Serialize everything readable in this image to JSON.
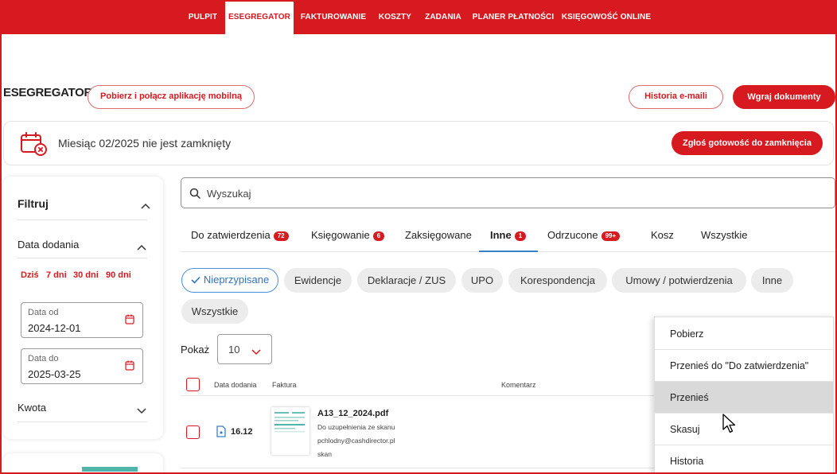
{
  "nav": {
    "items": [
      "PULPIT",
      "ESEGREGATOR",
      "FAKTUROWANIE",
      "KOSZTY",
      "ZADANIA",
      "PLANER PŁATNOŚCI",
      "KSIĘGOWOŚĆ ONLINE"
    ],
    "active": "ESEGREGATOR"
  },
  "header": {
    "title": "ESEGREGATOR",
    "mobile_button": "Pobierz i połącz aplikację mobilną",
    "history_button": "Historia e-maili",
    "upload_button": "Wgraj dokumenty"
  },
  "banner": {
    "text": "Miesiąc 02/2025 nie jest zamknięty",
    "button": "Zgłoś gotowość do zamknięcia"
  },
  "filter": {
    "title": "Filtruj",
    "date_section": "Data dodania",
    "quick_ranges": [
      "Dziś",
      "7 dni",
      "30 dni",
      "90 dni"
    ],
    "date_from_label": "Data od",
    "date_from_value": "2024-12-01",
    "date_to_label": "Data do",
    "date_to_value": "2025-03-25",
    "amount_section": "Kwota"
  },
  "search": {
    "placeholder": "Wyszukaj"
  },
  "tabs": [
    {
      "label": "Do zatwierdzenia",
      "badge": "72"
    },
    {
      "label": "Księgowanie",
      "badge": "6"
    },
    {
      "label": "Zaksięgowane",
      "badge": ""
    },
    {
      "label": "Inne",
      "badge": "1"
    },
    {
      "label": "Odrzucone",
      "badge": "99+"
    },
    {
      "label": "Kosz",
      "badge": ""
    },
    {
      "label": "Wszystkie",
      "badge": ""
    }
  ],
  "active_tab": "Inne",
  "chips": [
    "Nieprzypisane",
    "Ewidencje",
    "Deklaracje / ZUS",
    "UPO",
    "Korespondencja",
    "Umowy / potwierdzenia",
    "Inne",
    "Wszystkie"
  ],
  "selected_chip": "Nieprzypisane",
  "show": {
    "label": "Pokaż",
    "value": "10"
  },
  "table": {
    "columns": [
      "Data dodania",
      "Faktura",
      "Komentarz"
    ],
    "rows": [
      {
        "date": "16.12",
        "name": "A13_12_2024.pdf",
        "line1": "Do uzupełnienia ze skanu",
        "line2": "pchlodny@cashdirector.pl",
        "line3": "skan"
      }
    ]
  },
  "context_menu": {
    "items": [
      "Pobierz",
      "Przenieś do \"Do zatwierdzenia\"",
      "Przenieś",
      "Skasuj",
      "Historia"
    ],
    "hovered": "Przenieś"
  },
  "colors": {
    "brand": "#d71920",
    "accent_blue": "#3b7fc4"
  },
  "icons": [
    "calendar-x-icon",
    "chevron-up-icon",
    "chevron-down-icon",
    "calendar-icon",
    "search-icon",
    "check-icon",
    "file-icon",
    "cursor-icon"
  ]
}
